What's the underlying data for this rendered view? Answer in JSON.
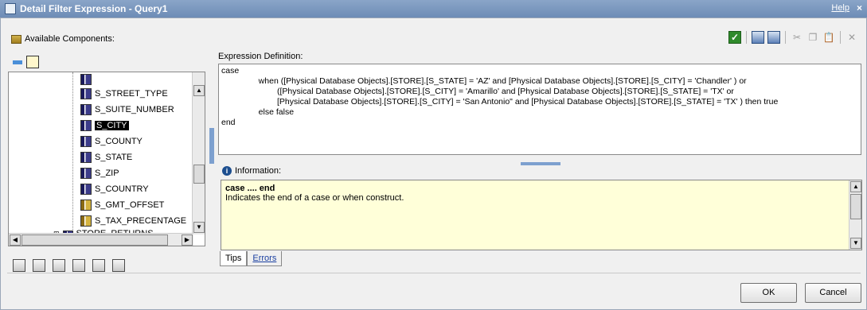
{
  "window": {
    "title": "Detail Filter Expression - Query1",
    "help": "Help",
    "close": "×"
  },
  "left": {
    "heading": "Available Components:",
    "tree": [
      {
        "label": "S_STREET_TYPE",
        "icon": "column-icon",
        "selected": false
      },
      {
        "label": "S_SUITE_NUMBER",
        "icon": "column-icon",
        "selected": false
      },
      {
        "label": "S_CITY",
        "icon": "column-icon",
        "selected": true
      },
      {
        "label": "S_COUNTY",
        "icon": "column-icon",
        "selected": false
      },
      {
        "label": "S_STATE",
        "icon": "column-icon",
        "selected": false
      },
      {
        "label": "S_ZIP",
        "icon": "column-icon",
        "selected": false
      },
      {
        "label": "S_COUNTRY",
        "icon": "column-icon",
        "selected": false
      },
      {
        "label": "S_GMT_OFFSET",
        "icon": "measure-icon",
        "selected": false
      },
      {
        "label": "S_TAX_PRECENTAGE",
        "icon": "measure-icon",
        "selected": false
      }
    ],
    "tree_parent": "STORE_RETURNS"
  },
  "expression": {
    "label": "Expression Definition:",
    "lines": [
      "case",
      "                when ([Physical Database Objects].[STORE].[S_STATE] = 'AZ' and [Physical Database Objects].[STORE].[S_CITY] = 'Chandler' ) or",
      "                        ([Physical Database Objects].[STORE].[S_CITY] = 'Amarillo' and [Physical Database Objects].[STORE].[S_STATE] = 'TX' or",
      "                        [Physical Database Objects].[STORE].[S_CITY] = 'San Antonio\" and [Physical Database Objects].[STORE].[S_STATE] = 'TX' ) then true",
      "                else false",
      "end"
    ]
  },
  "information": {
    "label": "Information:",
    "keyword": "case .... end",
    "description": "Indicates the end of a case or when construct."
  },
  "tabs": {
    "tips": "Tips",
    "errors": "Errors"
  },
  "buttons": {
    "ok": "OK",
    "cancel": "Cancel"
  }
}
